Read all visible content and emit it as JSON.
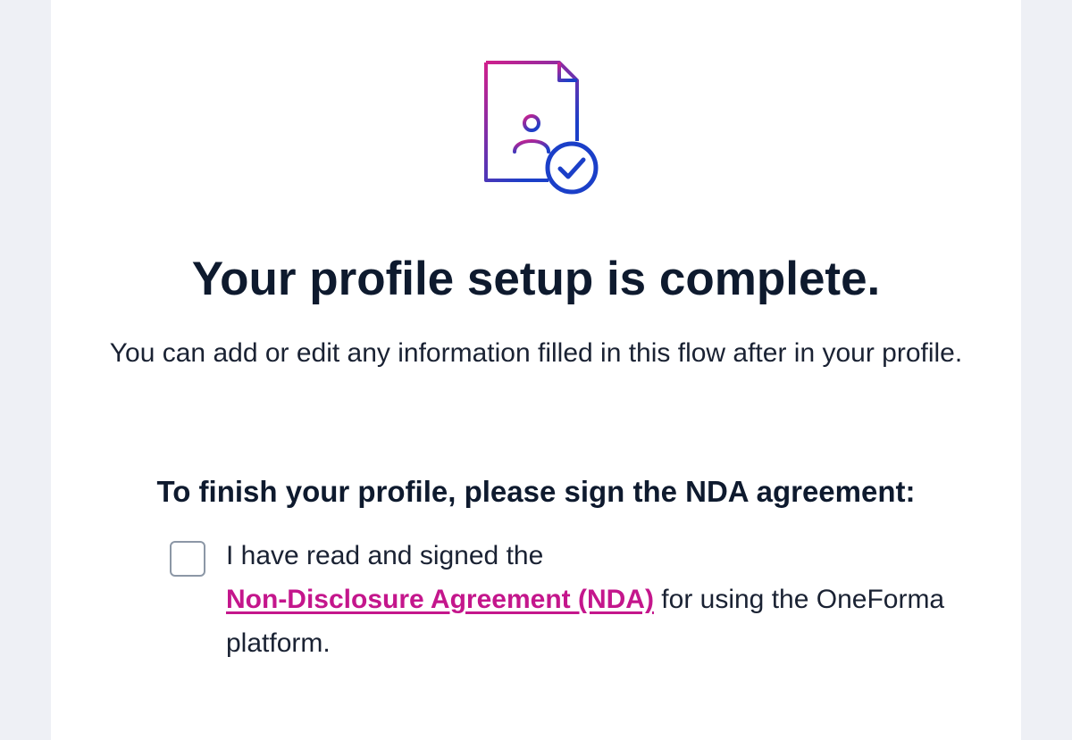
{
  "icons": {
    "hero": "document-profile-check-icon",
    "checkbox": "checkbox-unchecked"
  },
  "colors": {
    "link": "#c4168c",
    "icon_gradient_start": "#d0208c",
    "icon_gradient_end": "#1b3fc8",
    "heading_text": "#0e1a2e"
  },
  "completion": {
    "title": "Your profile setup is complete.",
    "subtitle": "You can add or edit any information filled in this flow after in your profile."
  },
  "nda": {
    "heading": "To finish your profile, please sign the NDA agreement:",
    "checkbox_checked": false,
    "consent_prefix": "I have read and signed the",
    "link_text": "Non-Disclosure Agreement (NDA)",
    "consent_suffix": "for using the OneForma platform."
  }
}
